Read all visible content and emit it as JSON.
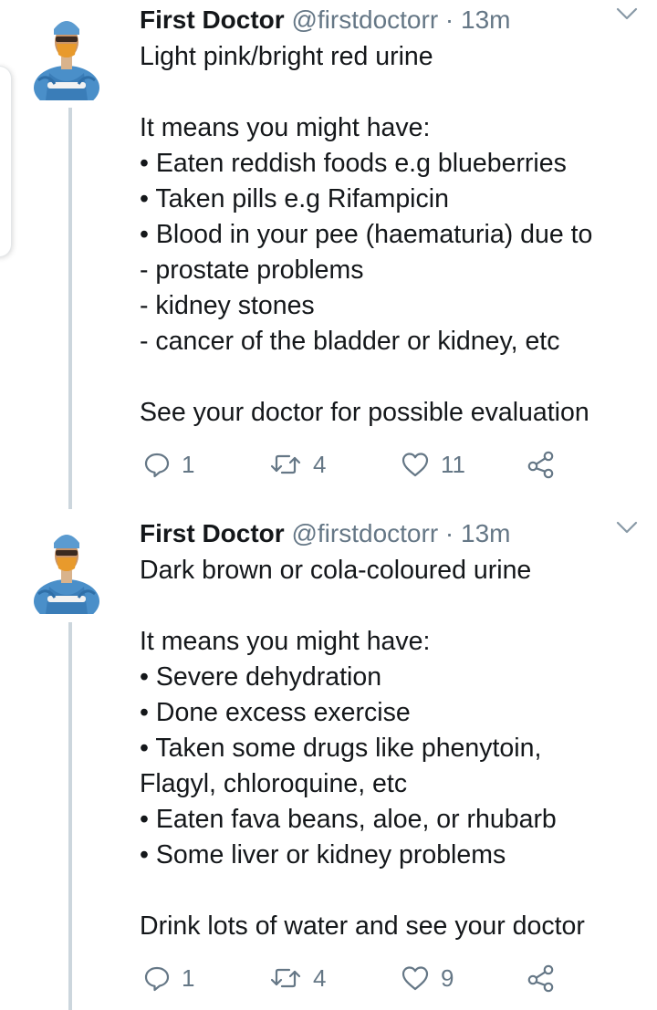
{
  "tweets": [
    {
      "name": "First Doctor",
      "handle": "@firstdoctorr",
      "separator": "·",
      "time": "13m",
      "lines": [
        "Light pink/bright red urine",
        "",
        "It means you might have:",
        "• Eaten reddish foods e.g blueberries",
        "• Taken pills e.g Rifampicin",
        "• Blood in your pee (haematuria) due to",
        "- prostate problems",
        "- kidney stones",
        "- cancer of the bladder or kidney, etc",
        "",
        "See your doctor for possible evaluation"
      ],
      "reply_count": "1",
      "retweet_count": "4",
      "like_count": "11"
    },
    {
      "name": "First Doctor",
      "handle": "@firstdoctorr",
      "separator": "·",
      "time": "13m",
      "lines": [
        "Dark brown or cola-coloured urine",
        "",
        "It means you might have:",
        "• Severe dehydration",
        "• Done excess exercise",
        "• Taken some drugs like phenytoin,",
        "Flagyl, chloroquine, etc",
        "• Eaten fava beans, aloe, or rhubarb",
        "• Some liver or kidney problems",
        "",
        "Drink lots of water and see your doctor"
      ],
      "reply_count": "1",
      "retweet_count": "4",
      "like_count": "9"
    }
  ],
  "icons": {
    "reply": "reply-icon",
    "retweet": "retweet-icon",
    "like": "heart-icon",
    "share": "share-icon",
    "menu": "chevron-down-icon"
  },
  "colors": {
    "text": "#14171a",
    "secondary": "#657786",
    "thread_line": "#ccd6dd",
    "scrub_blue": "#4a8fc9",
    "mask_orange": "#e89a2c"
  }
}
